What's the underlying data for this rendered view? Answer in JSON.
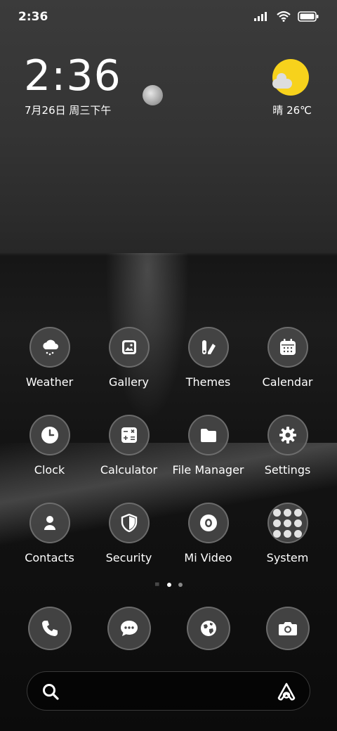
{
  "status_bar": {
    "time": "2:36",
    "icons": [
      "signal-icon",
      "wifi-icon",
      "battery-icon"
    ]
  },
  "clock_widget": {
    "time": "2:36",
    "date": "7月26日 周三下午"
  },
  "weather_widget": {
    "condition_temp": "晴 26℃",
    "icon": "sunny-cloud-icon",
    "sun_color": "#f7d21c"
  },
  "apps": [
    {
      "label": "Weather",
      "icon": "weather-icon"
    },
    {
      "label": "Gallery",
      "icon": "gallery-icon"
    },
    {
      "label": "Themes",
      "icon": "themes-icon"
    },
    {
      "label": "Calendar",
      "icon": "calendar-icon"
    },
    {
      "label": "Clock",
      "icon": "clock-icon"
    },
    {
      "label": "Calculator",
      "icon": "calculator-icon"
    },
    {
      "label": "File Manager",
      "icon": "folder-icon"
    },
    {
      "label": "Settings",
      "icon": "gear-icon"
    },
    {
      "label": "Contacts",
      "icon": "contacts-icon"
    },
    {
      "label": "Security",
      "icon": "shield-icon"
    },
    {
      "label": "Mi Video",
      "icon": "video-icon"
    },
    {
      "label": "System",
      "icon": "system-folder-icon"
    }
  ],
  "page_indicator": {
    "pages": 2,
    "current": 1
  },
  "dock": [
    {
      "icon": "phone-icon"
    },
    {
      "icon": "messages-icon"
    },
    {
      "icon": "browser-icon"
    },
    {
      "icon": "camera-icon"
    }
  ],
  "search_bar": {
    "left_icon": "search-icon",
    "right_icon": "assistant-icon"
  }
}
